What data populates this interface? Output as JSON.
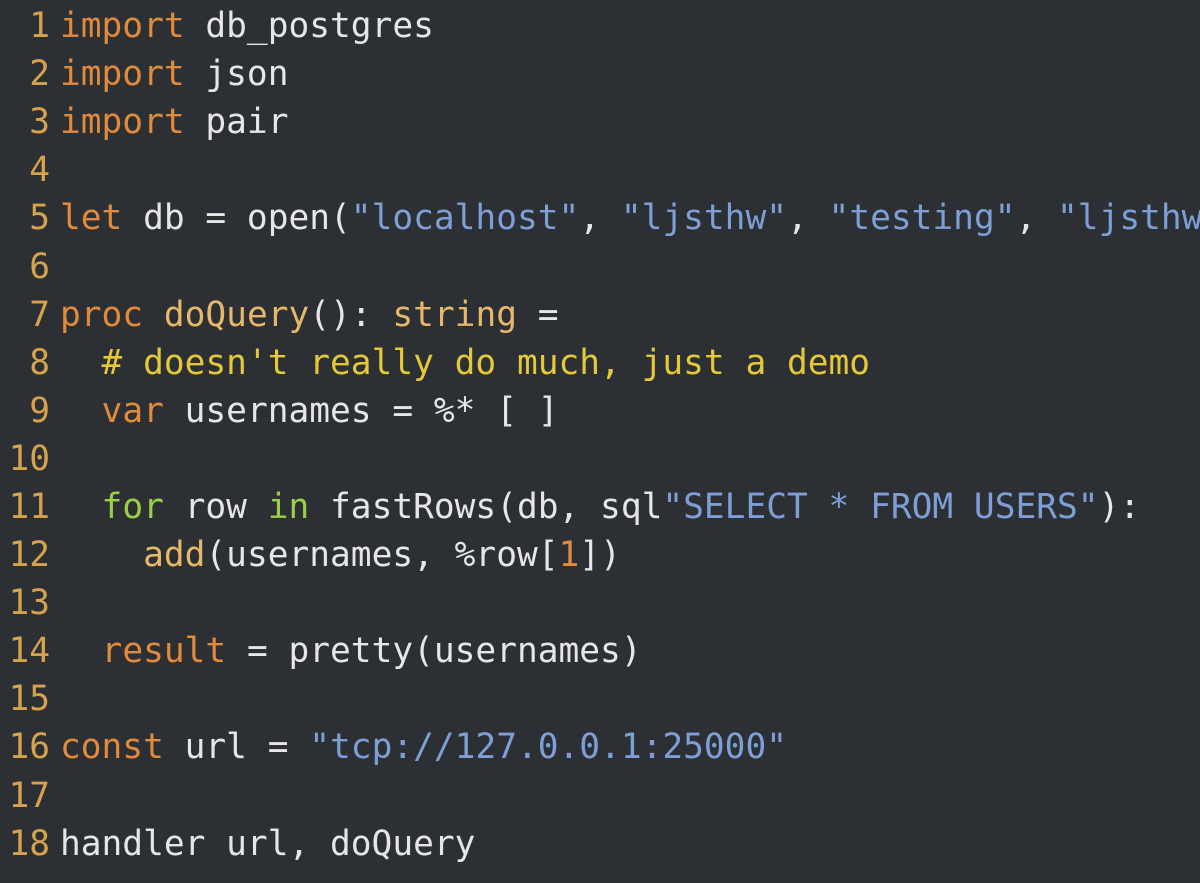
{
  "colors": {
    "background": "#2c2f33",
    "line_number": "#d6a24b",
    "keyword": "#e08a3c",
    "function": "#e6b86a",
    "string": "#7e9fd6",
    "comment": "#e3c93a",
    "loop_keyword": "#9bcf4a",
    "number": "#e08a3c",
    "text": "#e6e6e6"
  },
  "lines": [
    {
      "n": "1",
      "tokens": [
        {
          "t": "kw",
          "v": "import"
        },
        {
          "t": "txt",
          "v": " db_postgres"
        }
      ]
    },
    {
      "n": "2",
      "tokens": [
        {
          "t": "kw",
          "v": "import"
        },
        {
          "t": "txt",
          "v": " json"
        }
      ]
    },
    {
      "n": "3",
      "tokens": [
        {
          "t": "kw",
          "v": "import"
        },
        {
          "t": "txt",
          "v": " pair"
        }
      ]
    },
    {
      "n": "4",
      "tokens": []
    },
    {
      "n": "5",
      "tokens": [
        {
          "t": "kw",
          "v": "let"
        },
        {
          "t": "txt",
          "v": " db = open("
        },
        {
          "t": "str",
          "v": "\"localhost\""
        },
        {
          "t": "txt",
          "v": ", "
        },
        {
          "t": "str",
          "v": "\"ljsthw\""
        },
        {
          "t": "txt",
          "v": ", "
        },
        {
          "t": "str",
          "v": "\"testing\""
        },
        {
          "t": "txt",
          "v": ", "
        },
        {
          "t": "str",
          "v": "\"ljsthw\""
        },
        {
          "t": "txt",
          "v": ")"
        }
      ]
    },
    {
      "n": "6",
      "tokens": []
    },
    {
      "n": "7",
      "tokens": [
        {
          "t": "kw",
          "v": "proc"
        },
        {
          "t": "txt",
          "v": " "
        },
        {
          "t": "fn",
          "v": "doQuery"
        },
        {
          "t": "txt",
          "v": "(): "
        },
        {
          "t": "fn",
          "v": "string"
        },
        {
          "t": "txt",
          "v": " ="
        }
      ]
    },
    {
      "n": "8",
      "tokens": [
        {
          "t": "txt",
          "v": "  "
        },
        {
          "t": "cm",
          "v": "# doesn't really do much, just a demo"
        }
      ]
    },
    {
      "n": "9",
      "tokens": [
        {
          "t": "txt",
          "v": "  "
        },
        {
          "t": "kw",
          "v": "var"
        },
        {
          "t": "txt",
          "v": " usernames = %* [ ]"
        }
      ]
    },
    {
      "n": "10",
      "tokens": []
    },
    {
      "n": "11",
      "tokens": [
        {
          "t": "txt",
          "v": "  "
        },
        {
          "t": "kw2",
          "v": "for"
        },
        {
          "t": "txt",
          "v": " row "
        },
        {
          "t": "kw2",
          "v": "in"
        },
        {
          "t": "txt",
          "v": " fastRows(db, sql"
        },
        {
          "t": "str",
          "v": "\"SELECT * FROM USERS\""
        },
        {
          "t": "txt",
          "v": "):"
        }
      ]
    },
    {
      "n": "12",
      "tokens": [
        {
          "t": "txt",
          "v": "    "
        },
        {
          "t": "fn",
          "v": "add"
        },
        {
          "t": "txt",
          "v": "(usernames, %row["
        },
        {
          "t": "num",
          "v": "1"
        },
        {
          "t": "txt",
          "v": "])"
        }
      ]
    },
    {
      "n": "13",
      "tokens": []
    },
    {
      "n": "14",
      "tokens": [
        {
          "t": "txt",
          "v": "  "
        },
        {
          "t": "kw",
          "v": "result"
        },
        {
          "t": "txt",
          "v": " = pretty(usernames)"
        }
      ]
    },
    {
      "n": "15",
      "tokens": []
    },
    {
      "n": "16",
      "tokens": [
        {
          "t": "kw",
          "v": "const"
        },
        {
          "t": "txt",
          "v": " url = "
        },
        {
          "t": "str",
          "v": "\"tcp://127.0.0.1:25000\""
        }
      ]
    },
    {
      "n": "17",
      "tokens": []
    },
    {
      "n": "18",
      "tokens": [
        {
          "t": "txt",
          "v": "handler url, doQuery"
        }
      ]
    }
  ]
}
